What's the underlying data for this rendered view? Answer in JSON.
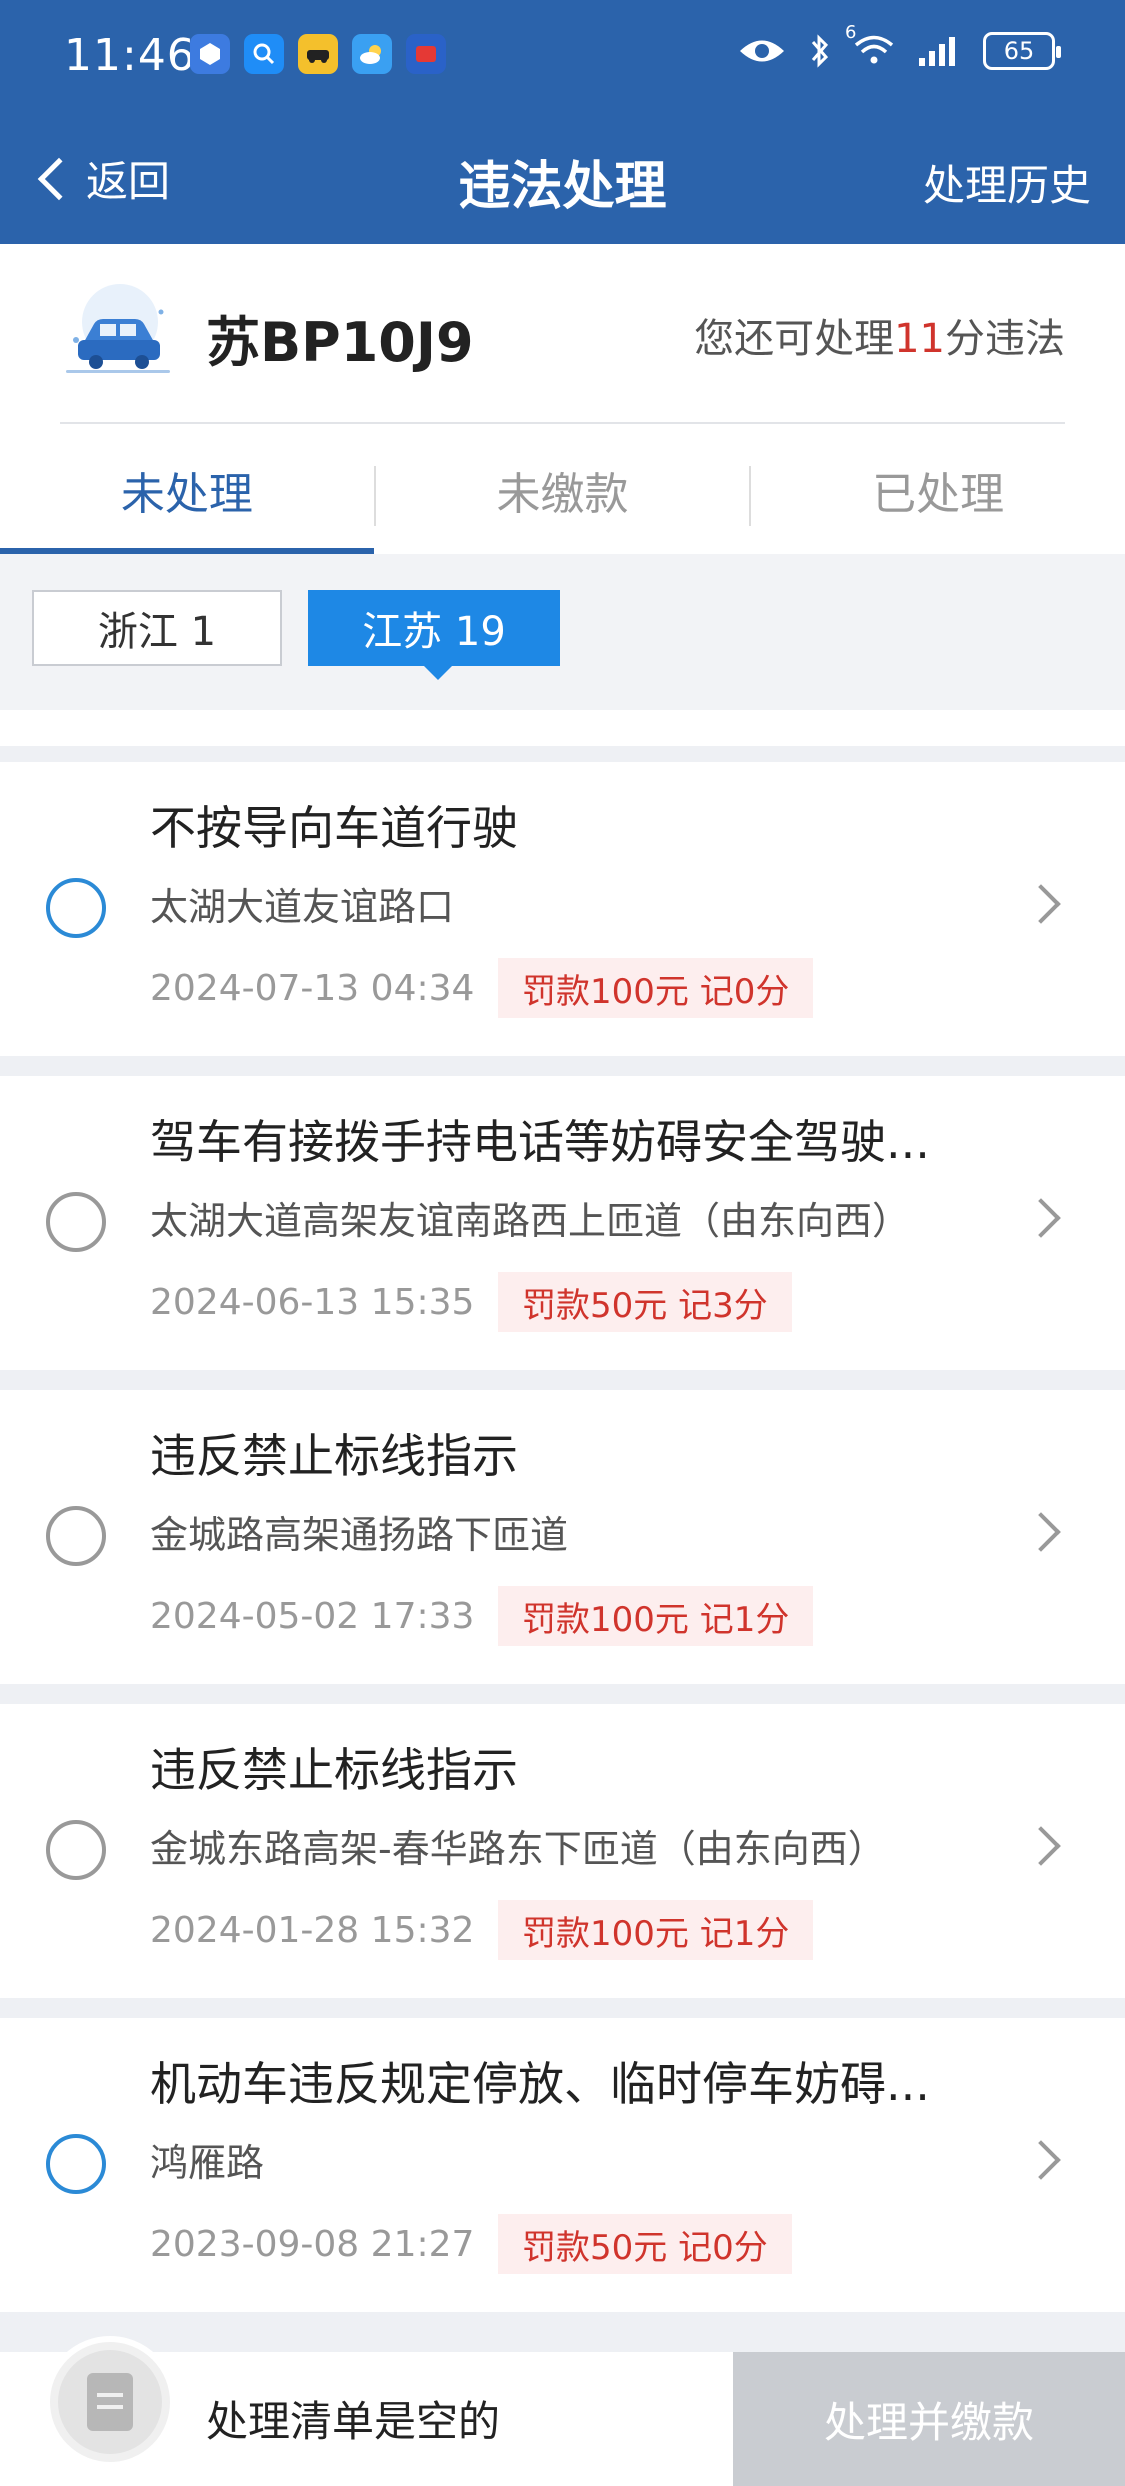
{
  "status_bar": {
    "time": "11:46",
    "network": "6",
    "battery": "65"
  },
  "nav": {
    "back_label": "返回",
    "title": "违法处理",
    "history_label": "处理历史"
  },
  "vehicle": {
    "plate": "苏BP10J9",
    "remain_prefix": "您还可处理",
    "remain_points": "11",
    "remain_suffix": "分违法"
  },
  "tabs": [
    {
      "label": "未处理",
      "active": true
    },
    {
      "label": "未缴款",
      "active": false
    },
    {
      "label": "已处理",
      "active": false
    }
  ],
  "provinces": [
    {
      "label": "浙江 1",
      "selected": false
    },
    {
      "label": "江苏 19",
      "selected": true
    }
  ],
  "violations": [
    {
      "title": "不按导向车道行驶",
      "location": "太湖大道友谊路口",
      "date": "2024-07-13 04:34",
      "fine": "罚款100元 记0分",
      "radio_color": "#2b8ad6"
    },
    {
      "title": "驾车有接拨手持电话等妨碍安全驾驶...",
      "location": "太湖大道高架友谊南路西上匝道（由东向西）",
      "date": "2024-06-13 15:35",
      "fine": "罚款50元 记3分",
      "radio_color": "#999999"
    },
    {
      "title": "违反禁止标线指示",
      "location": "金城路高架通扬路下匝道",
      "date": "2024-05-02 17:33",
      "fine": "罚款100元 记1分",
      "radio_color": "#999999"
    },
    {
      "title": "违反禁止标线指示",
      "location": "金城东路高架-春华路东下匝道（由东向西）",
      "date": "2024-01-28 15:32",
      "fine": "罚款100元 记1分",
      "radio_color": "#999999"
    },
    {
      "title": "机动车违反规定停放、临时停车妨碍...",
      "location": "鸿雁路",
      "date": "2023-09-08 21:27",
      "fine": "罚款50元 记0分",
      "radio_color": "#2b8ad6"
    }
  ],
  "bottom": {
    "empty_text": "处理清单是空的",
    "pay_button": "处理并缴款"
  },
  "colors": {
    "primary": "#2b63ab",
    "accent": "#1e88e5",
    "fine_text": "#d0342c",
    "fine_bg": "#fdeeee"
  }
}
